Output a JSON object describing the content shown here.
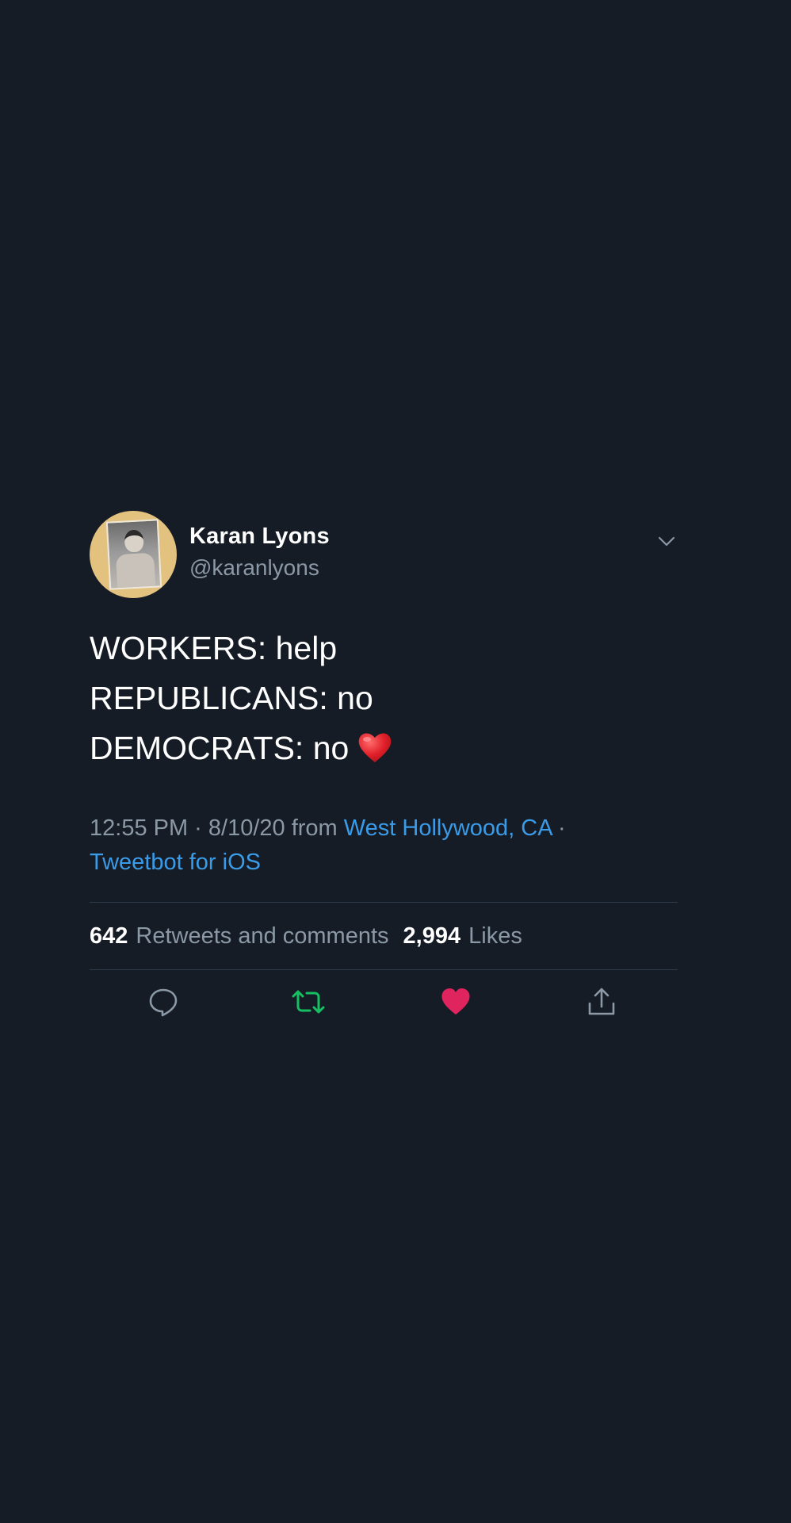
{
  "author": {
    "name": "Karan Lyons",
    "handle": "@karanlyons"
  },
  "tweet": {
    "lines": [
      "WORKERS: help",
      "REPUBLICANS: no",
      "DEMOCRATS: no"
    ],
    "emoji": "heart-emoji"
  },
  "meta": {
    "timestamp": "12:55 PM · 8/10/20 from ",
    "location": "West Hollywood, CA",
    "separator": " ·",
    "client": "Tweetbot for iOS"
  },
  "stats": {
    "retweets_count": "642",
    "retweets_label": "Retweets and comments",
    "likes_count": "2,994",
    "likes_label": "Likes"
  },
  "actions": {
    "reply_icon": "comment-icon",
    "retweet_icon": "retweet-icon",
    "like_icon": "heart-icon",
    "share_icon": "share-icon"
  },
  "colors": {
    "background": "#161c26",
    "link": "#3a9ce8",
    "retweet_active": "#17bf63",
    "like_active": "#e0245e",
    "secondary_text": "#8b98a5"
  }
}
